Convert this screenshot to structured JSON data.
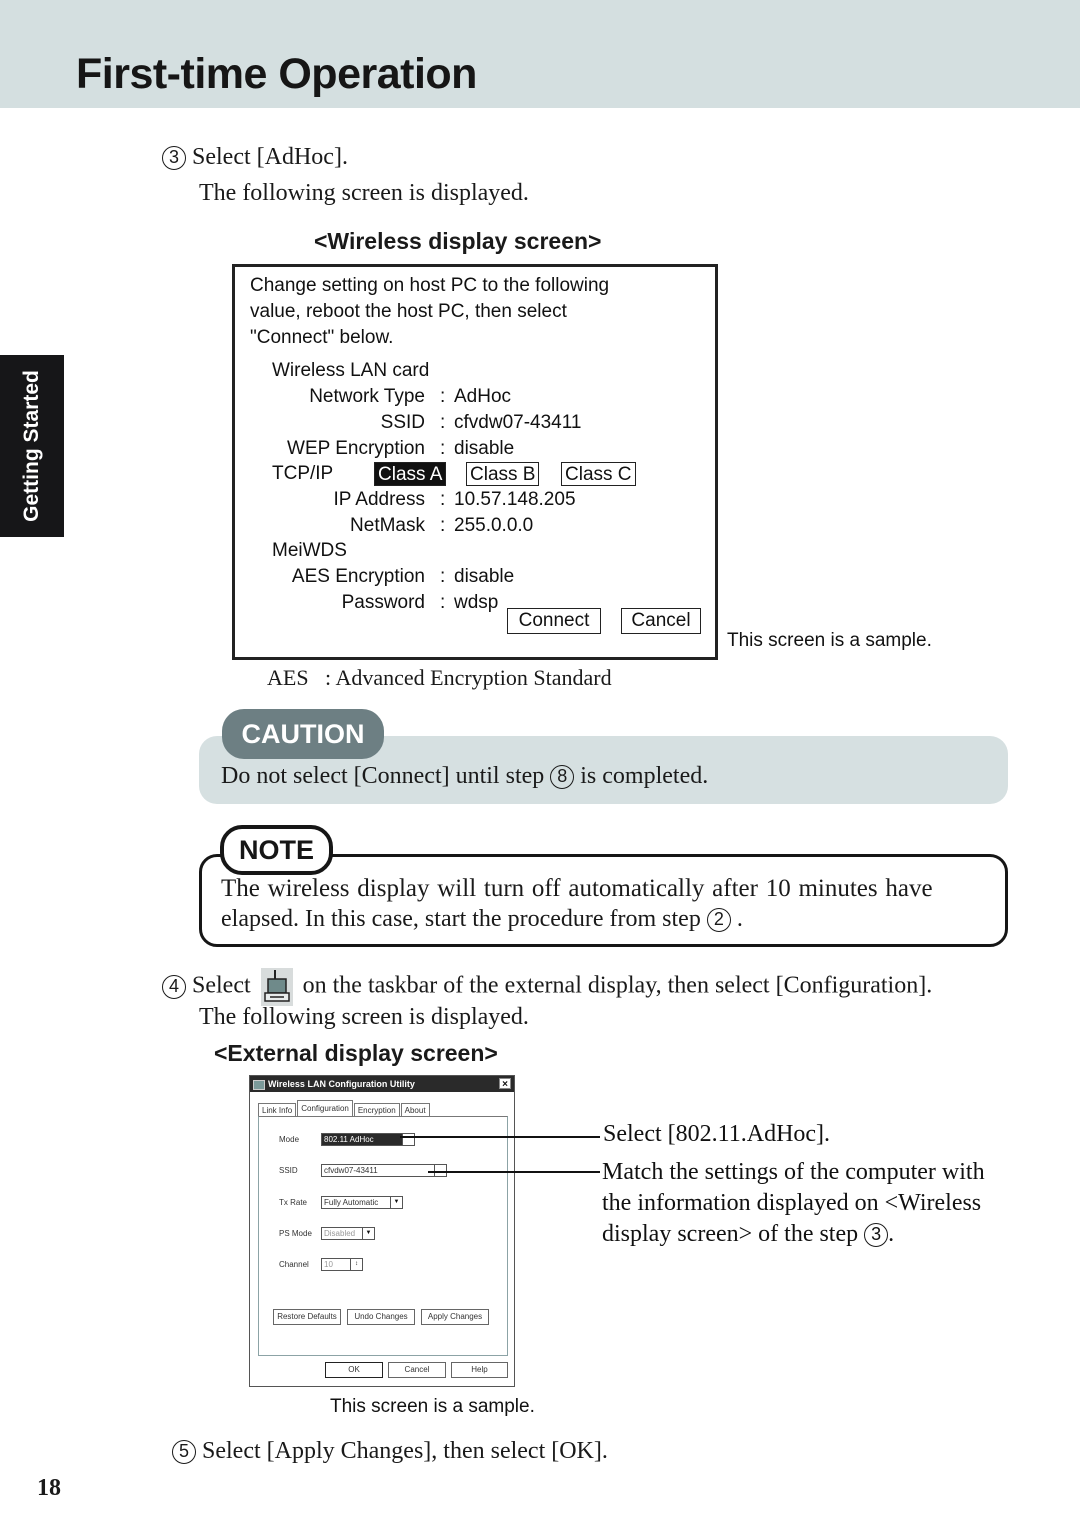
{
  "header": {
    "title": "First-time Operation",
    "band_color": "#d4dfe0"
  },
  "side_tab": {
    "label": "Getting Started",
    "color": "#161618"
  },
  "step3": {
    "number": "3",
    "text": "Select [AdHoc].",
    "subtext": "The following screen is displayed."
  },
  "wireless_screen": {
    "heading": "<Wireless display screen>",
    "intro_lines": [
      "Change setting on host PC to the following",
      "value, reboot the host PC, then select",
      "\"Connect\" below."
    ],
    "section_lan": "Wireless LAN card",
    "fields_lan": [
      {
        "label": "Network Type",
        "value": "AdHoc"
      },
      {
        "label": "SSID",
        "value": "cfvdw07-43411"
      },
      {
        "label": "WEP Encryption",
        "value": "disable"
      }
    ],
    "tcpip_label": "TCP/IP",
    "class_options": [
      {
        "label": "Class A",
        "selected": true
      },
      {
        "label": "Class B",
        "selected": false
      },
      {
        "label": "Class C",
        "selected": false
      }
    ],
    "fields_ip": [
      {
        "label": "IP Address",
        "value": "10.57.148.205"
      },
      {
        "label": "NetMask",
        "value": "255.0.0.0"
      }
    ],
    "section_wds": "MeiWDS",
    "fields_wds": [
      {
        "label": "AES Encryption",
        "value": "disable"
      },
      {
        "label": "Password",
        "value": "wdsp"
      }
    ],
    "separator": ":",
    "connect_button": "Connect",
    "cancel_button": "Cancel",
    "sample_note": "This screen is a sample."
  },
  "aes_note": "AES   : Advanced Encryption Standard",
  "caution": {
    "label": "CAUTION",
    "text_before": "Do not select [Connect] until step",
    "step_ref": "8",
    "text_after": "is completed.",
    "label_color": "#6d7f83",
    "box_color": "#d6e0e1"
  },
  "note": {
    "label": "NOTE",
    "line1": "The wireless display will turn off automatically after 10 minutes have",
    "line2_before": "elapsed.  In this case, start the procedure from step",
    "step_ref": "2",
    "line2_after": "."
  },
  "step4": {
    "number": "4",
    "text_before": "Select",
    "icon": "wireless-utility-taskbar-icon",
    "text_after": "on the taskbar of the external display, then select [Configuration].",
    "subtext": "The following screen is displayed."
  },
  "external_screen": {
    "heading": "<External display screen>",
    "dialog": {
      "title": "Wireless LAN Configuration Utility",
      "close": "×",
      "tabs": [
        {
          "label": "Link Info",
          "active": false
        },
        {
          "label": "Configuration",
          "active": true
        },
        {
          "label": "Encryption",
          "active": false
        },
        {
          "label": "About",
          "active": false
        }
      ],
      "fields": [
        {
          "label": "Mode",
          "value": "802.11 AdHoc"
        },
        {
          "label": "SSID",
          "value": "cfvdw07-43411"
        },
        {
          "label": "Tx Rate",
          "value": "Fully Automatic"
        },
        {
          "label": "PS Mode",
          "value": "Disabled"
        },
        {
          "label": "Channel",
          "value": "10"
        }
      ],
      "action_buttons": [
        "Restore Defaults",
        "Undo Changes",
        "Apply Changes"
      ],
      "footer_buttons": [
        "OK",
        "Cancel",
        "Help"
      ]
    },
    "callout_mode": "Select [802.11.AdHoc].",
    "callout_ssid_lines": [
      "Match the settings of the computer with",
      "the information displayed on <Wireless"
    ],
    "callout_ssid_last_before": "display screen> of the step",
    "callout_ssid_step_ref": "3",
    "callout_ssid_last_after": ".",
    "sample_note": "This screen is a sample."
  },
  "step5": {
    "number": "5",
    "text": "Select [Apply Changes], then select [OK]."
  },
  "page_number": "18"
}
